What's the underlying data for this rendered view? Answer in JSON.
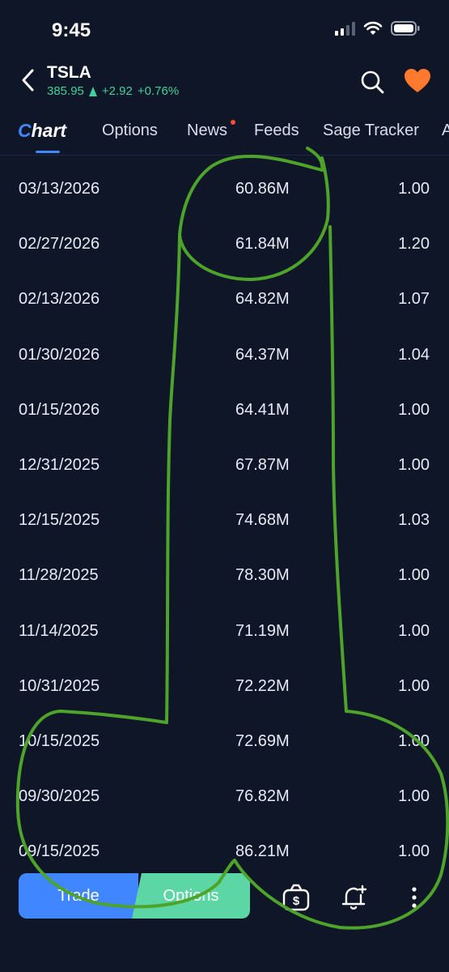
{
  "status_bar": {
    "time": "9:45"
  },
  "header": {
    "ticker": "TSLA",
    "price": "385.95",
    "change": "+2.92",
    "change_percent": "+0.76%",
    "up_color": "#3fd29a",
    "heart_color": "#ff7a2e"
  },
  "tabs": [
    {
      "label_prefix": "C",
      "label_rest": "hart",
      "active": true
    },
    {
      "label": "Options"
    },
    {
      "label": "News",
      "has_dot": true
    },
    {
      "label": "Feeds"
    },
    {
      "label": "Sage Tracker"
    },
    {
      "label": "A"
    }
  ],
  "rows": [
    {
      "date": "03/13/2026",
      "volume": "60.86M",
      "ratio": "1.00"
    },
    {
      "date": "02/27/2026",
      "volume": "61.84M",
      "ratio": "1.20"
    },
    {
      "date": "02/13/2026",
      "volume": "64.82M",
      "ratio": "1.07"
    },
    {
      "date": "01/30/2026",
      "volume": "64.37M",
      "ratio": "1.04"
    },
    {
      "date": "01/15/2026",
      "volume": "64.41M",
      "ratio": "1.00"
    },
    {
      "date": "12/31/2025",
      "volume": "67.87M",
      "ratio": "1.00"
    },
    {
      "date": "12/15/2025",
      "volume": "74.68M",
      "ratio": "1.03"
    },
    {
      "date": "11/28/2025",
      "volume": "78.30M",
      "ratio": "1.00"
    },
    {
      "date": "11/14/2025",
      "volume": "71.19M",
      "ratio": "1.00"
    },
    {
      "date": "10/31/2025",
      "volume": "72.22M",
      "ratio": "1.00"
    },
    {
      "date": "10/15/2025",
      "volume": "72.69M",
      "ratio": "1.00"
    },
    {
      "date": "09/30/2025",
      "volume": "76.82M",
      "ratio": "1.00"
    },
    {
      "date": "09/15/2025",
      "volume": "86.21M",
      "ratio": "1.00"
    }
  ],
  "bottom_bar": {
    "trade_label": "Trade",
    "options_label": "Options",
    "icons": [
      "money-icon",
      "bell-plus-icon",
      "more-vertical-icon"
    ]
  },
  "colors": {
    "background": "#0f1628",
    "accent_blue": "#3f86ff",
    "accent_green": "#5cd6a4",
    "annotation_green": "#4ea32a"
  }
}
